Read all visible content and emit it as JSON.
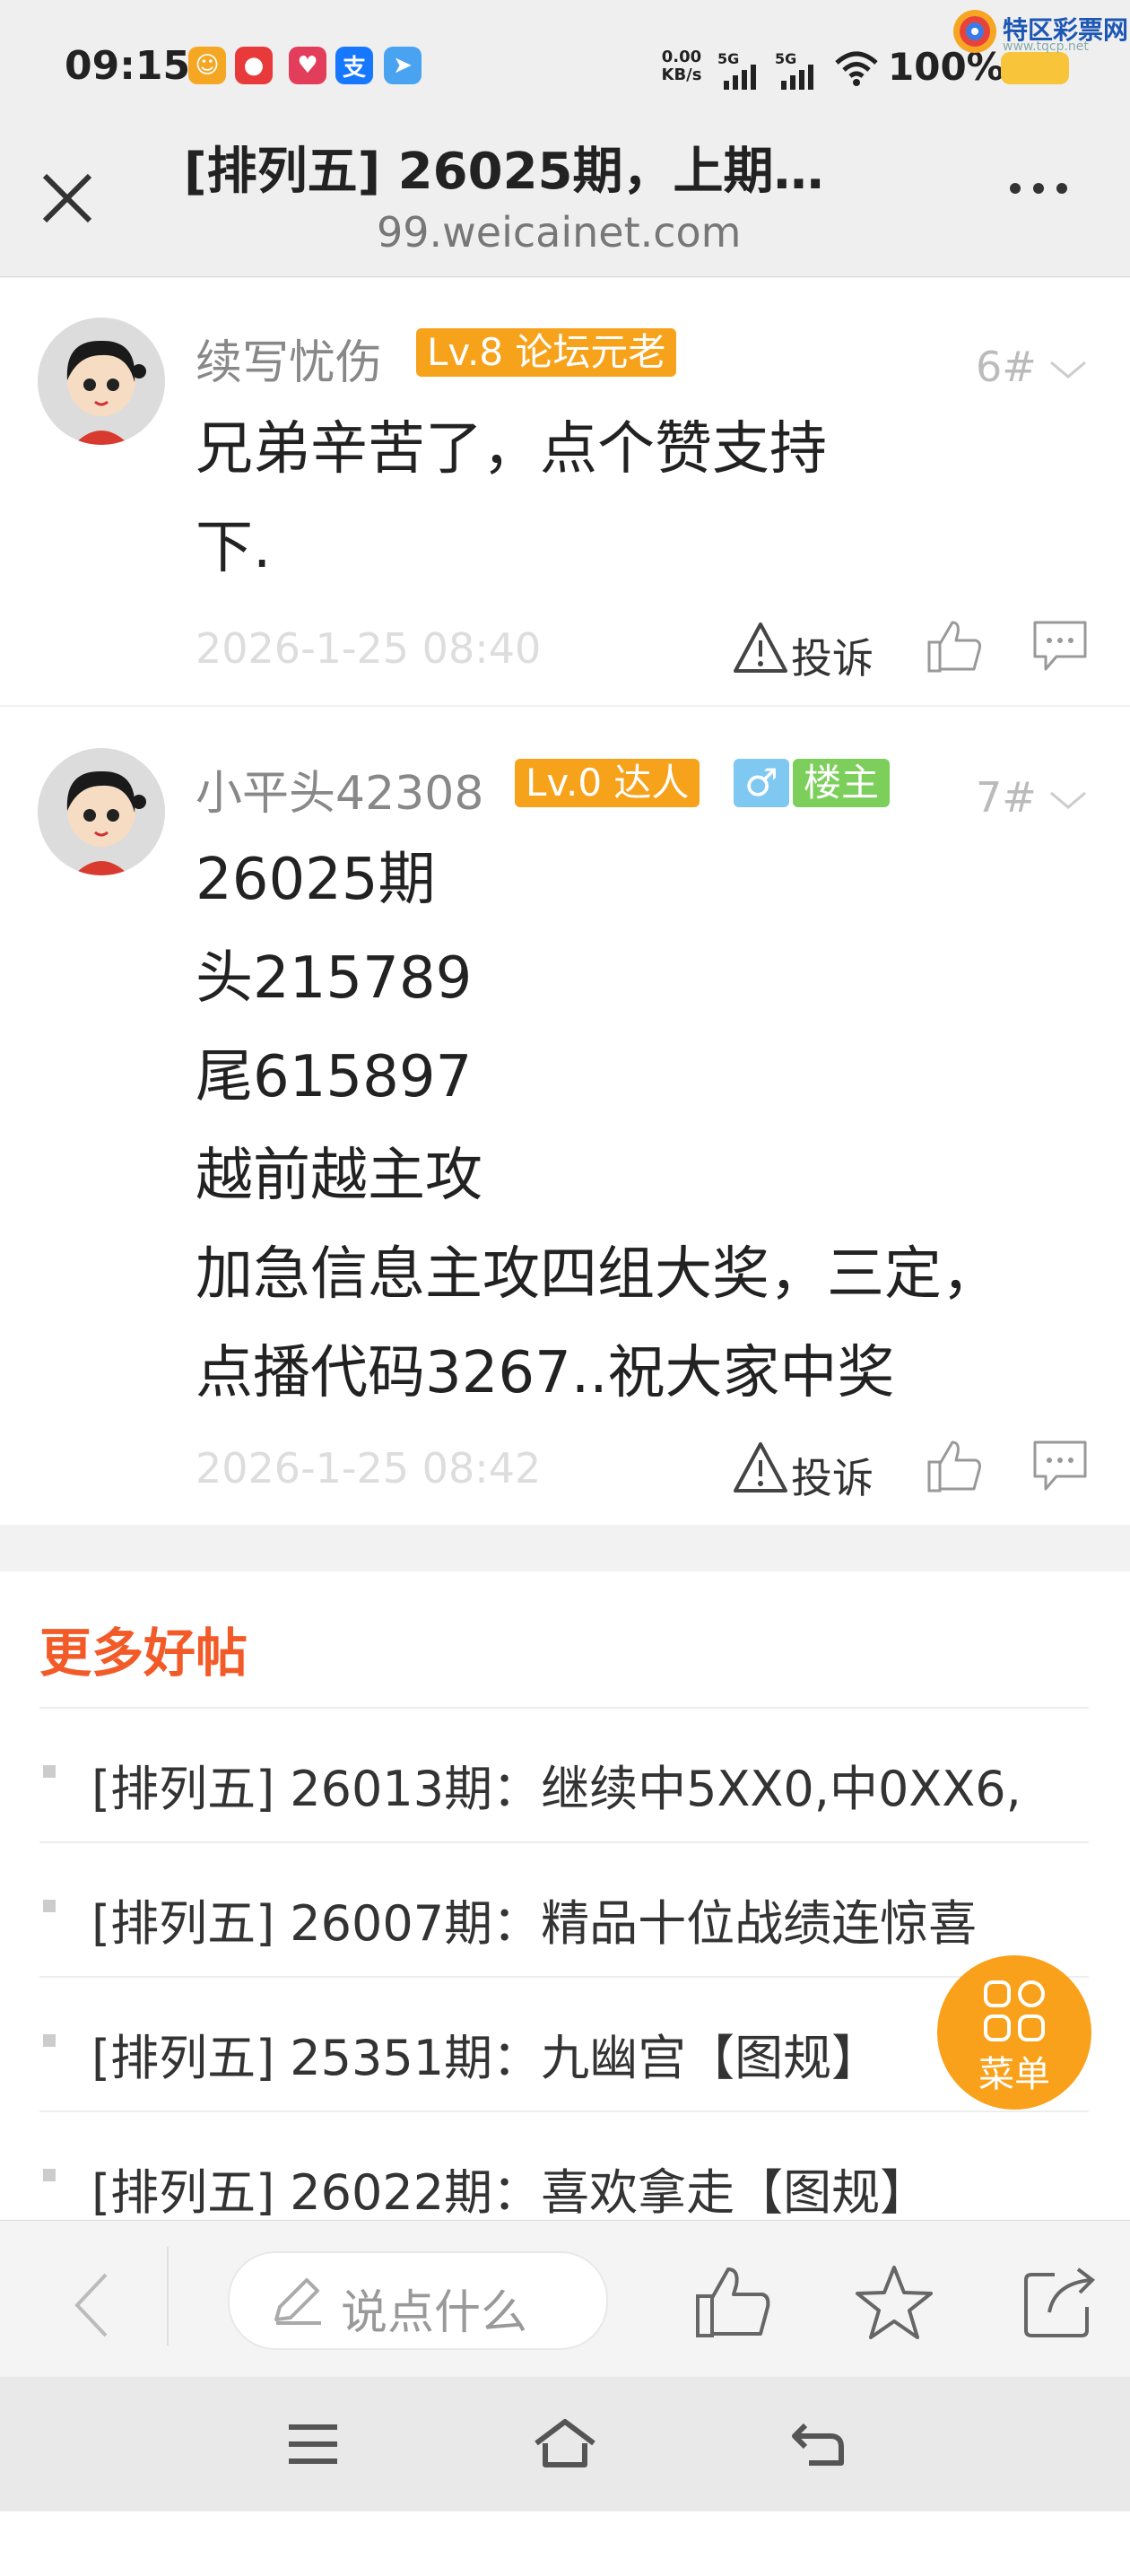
{
  "status": {
    "time": "09:15",
    "net_speed_value": "0.00",
    "net_speed_unit": "KB/s",
    "sim1": "5G",
    "sim2": "5G",
    "battery": "100%",
    "brand_name": "特区彩票网",
    "brand_url": "www.tqcp.net"
  },
  "header": {
    "title": "[排列五] 26025期，上期…",
    "url": "99.weicainet.com"
  },
  "posts": [
    {
      "username": "续写忧伤",
      "level_badge": "Lv.8 论坛元老",
      "floor": "6#",
      "body_lines": [
        "兄弟辛苦了，点个赞支持",
        "下."
      ],
      "time": "2026-1-25 08:40",
      "report_label": "投诉"
    },
    {
      "username": "小平头42308",
      "level_badge": "Lv.0 达人",
      "gender_badge": "♂",
      "host_badge": "楼主",
      "floor": "7#",
      "body_lines": [
        "26025期",
        "头215789",
        "尾615897",
        "越前越主攻",
        "加急信息主攻四组大奖，三定，",
        "点播代码3267..祝大家中奖"
      ],
      "time": "2026-1-25 08:42",
      "report_label": "投诉"
    }
  ],
  "more_posts": {
    "title": "更多好帖",
    "items": [
      "[排列五] 26013期：继续中5XX0,中0XX6,",
      "[排列五] 26007期：精品十位战绩连惊喜",
      "[排列五] 25351期：九幽宫【图规】",
      "[排列五] 26022期：喜欢拿走【图规】"
    ]
  },
  "menu_fab": {
    "label": "菜单"
  },
  "bottom_bar": {
    "comment_placeholder": "说点什么"
  },
  "colors": {
    "level_badge": "#f7a21b",
    "host_badge": "#7ccf5a",
    "gender_badge": "#7ec8f2",
    "more_title": "#f25a28",
    "menu_fab": "#f9a11b"
  }
}
